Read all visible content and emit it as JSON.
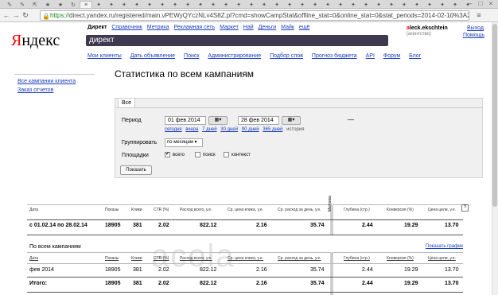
{
  "browser": {
    "tabs": [
      "✎",
      "✎",
      "⇱",
      "★",
      "★",
      "↻",
      "≡",
      "✦",
      "✦",
      "✦",
      "✦",
      "✦",
      "✦",
      "✦",
      "✦",
      "✦",
      "✦",
      "✦",
      "✦",
      "✦",
      "✦",
      "✦",
      "✦",
      "✦",
      "✦",
      "✦",
      "✦",
      "✦",
      "✦",
      "✦",
      "✦",
      "✦",
      "✦",
      "✦",
      "✦",
      "✦",
      "✦"
    ],
    "url_scheme": "https://",
    "url_rest": "direct.yandex.ru/registered/main.vPEWyQYczNLv4S8Z.pl?cmd=showCampStat&offline_stat=0&online_stat=0&stat_periods=2014-02-10%3A2014"
  },
  "logo": {
    "first": "Я",
    "rest": "ндекс"
  },
  "topnav": [
    "Директ",
    "Справочник",
    "Метрика",
    "Рекламная сеть",
    "Маркет",
    "Най",
    "Деньги",
    "Майк",
    "ещё"
  ],
  "direct_label": "директ",
  "user": {
    "first_letter": "a",
    "name": "leck.ekschtein",
    "role": "(агентство)"
  },
  "exit": "Выход",
  "help": "Помощь",
  "subnav": [
    "Мои клиенты",
    "Дать объявление",
    "Поиск",
    "Администрирование",
    "Подбор слов",
    "Прогноз бюджета",
    "API",
    "Форум",
    "Блог"
  ],
  "sidebar": [
    "Все кампании клиента",
    "Заказ отчетов"
  ],
  "title": "Статистика по всем кампаниям",
  "form": {
    "tab": "Все",
    "period_label": "Период",
    "date_from": "01 фев 2014",
    "date_to": "28 фев 2014",
    "quick_links": [
      "сегодня",
      "вчера",
      "7 дней",
      "30 дней",
      "90 дней",
      "365 дней"
    ],
    "history": "история",
    "group_label": "Группировать",
    "group_value": "по месяцам",
    "sites_label": "Площадки",
    "opt_all": "всего",
    "opt_search": "поиск",
    "opt_context": "контекст",
    "show": "Показать"
  },
  "table": {
    "headers": [
      "Дата",
      "Показы",
      "Клики",
      "CTR (%)",
      "Расход всего, у.е.",
      "Ср. цена клика, у.е.",
      "Ср. расход за день, у.е.",
      "Глубина (стр.)",
      "Конверсия (%)",
      "Цена цели, у.е."
    ],
    "vertical": "Метрика",
    "question": "?",
    "summary": [
      "с 01.02.14 по 28.02.14",
      "18905",
      "381",
      "2.02",
      "822.12",
      "2.16",
      "35.74",
      "2.44",
      "19.29",
      "13.70"
    ],
    "section": "По всем кампаниям",
    "show_chart": "Показать график",
    "rows": [
      [
        "фев 2014",
        "18905",
        "381",
        "2.02",
        "822.12",
        "2.16",
        "35.74",
        "2.44",
        "19.29",
        "13.70"
      ]
    ],
    "total": [
      "Итого:",
      "18905",
      "381",
      "2.02",
      "822.12",
      "2.16",
      "35.74",
      "2.44",
      "19.29",
      "13.70"
    ]
  }
}
